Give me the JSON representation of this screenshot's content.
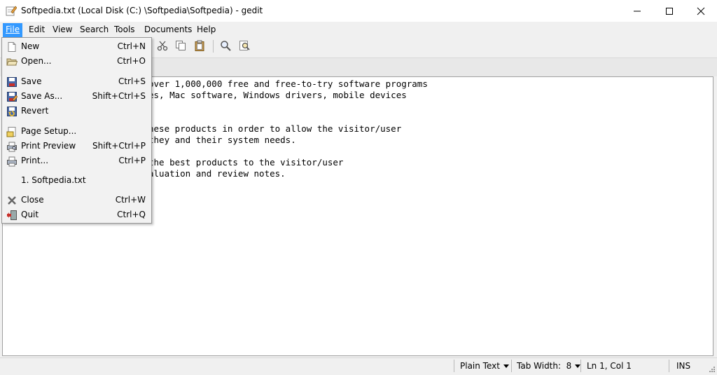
{
  "window": {
    "title": "Softpedia.txt (Local Disk (C:) \\Softpedia\\Softpedia) - gedit",
    "controls": [
      "minimize",
      "maximize",
      "close"
    ]
  },
  "menubar": {
    "items": [
      {
        "label": "File",
        "active": true
      },
      {
        "label": "Edit"
      },
      {
        "label": "View"
      },
      {
        "label": "Search"
      },
      {
        "label": "Tools"
      },
      {
        "label": "Documents"
      },
      {
        "label": "Help"
      }
    ]
  },
  "file_menu": {
    "items": [
      {
        "label": "New",
        "accel": "Ctrl+N",
        "icon": "new-document-icon"
      },
      {
        "label": "Open...",
        "accel": "Ctrl+O",
        "icon": "open-folder-icon"
      },
      {
        "label": "Save",
        "accel": "Ctrl+S",
        "icon": "save-icon"
      },
      {
        "label": "Save As...",
        "accel": "Shift+Ctrl+S",
        "icon": "save-as-icon"
      },
      {
        "label": "Revert",
        "accel": "",
        "icon": "revert-icon"
      },
      {
        "label": "Page Setup...",
        "accel": "",
        "icon": "page-setup-icon"
      },
      {
        "label": "Print Preview",
        "accel": "Shift+Ctrl+P",
        "icon": "print-preview-icon"
      },
      {
        "label": "Print...",
        "accel": "Ctrl+P",
        "icon": "print-icon"
      },
      {
        "label": "1. Softpedia.txt",
        "accel": "",
        "icon": ""
      },
      {
        "label": "Close",
        "accel": "Ctrl+W",
        "icon": "close-icon"
      },
      {
        "label": "Quit",
        "accel": "Ctrl+Q",
        "icon": "quit-icon"
      }
    ]
  },
  "editor": {
    "lines": [
      "over 1,000,000 free and free-to-try software programs",
      "es, Mac software, Windows drivers, mobile devices",
      "",
      "",
      "hese products in order to allow the visitor/user",
      "they and their system needs.",
      "",
      "the best products to the visitor/user",
      "aluation and review notes."
    ]
  },
  "statusbar": {
    "language": "Plain Text",
    "tab_width": "Tab Width:  8",
    "position": "Ln 1, Col 1",
    "mode": "INS"
  },
  "colors": {
    "menu_highlight": "#3399ff",
    "editor_bg": "#ffffff",
    "chrome_bg": "#f0f0f0"
  }
}
